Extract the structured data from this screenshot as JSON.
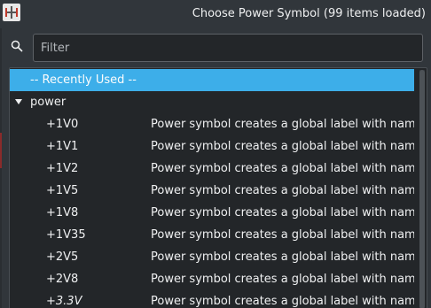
{
  "window": {
    "title": "Choose Power Symbol (99 items loaded)"
  },
  "search": {
    "placeholder": "Filter",
    "value": ""
  },
  "tree": {
    "recent_label": "-- Recently Used --",
    "group_label": "power",
    "items": [
      {
        "name": "+1V0",
        "description": "Power symbol creates a global label with name \"+"
      },
      {
        "name": "+1V1",
        "description": "Power symbol creates a global label with name \"+"
      },
      {
        "name": "+1V2",
        "description": "Power symbol creates a global label with name \"+"
      },
      {
        "name": "+1V5",
        "description": "Power symbol creates a global label with name \"+"
      },
      {
        "name": "+1V8",
        "description": "Power symbol creates a global label with name \"+"
      },
      {
        "name": "+1V35",
        "description": "Power symbol creates a global label with name \"+"
      },
      {
        "name": "+2V5",
        "description": "Power symbol creates a global label with name \"+"
      },
      {
        "name": "+2V8",
        "description": "Power symbol creates a global label with name \"+"
      },
      {
        "name": "+3.3V",
        "description": "Power symbol creates a global label with name \"+"
      }
    ]
  }
}
